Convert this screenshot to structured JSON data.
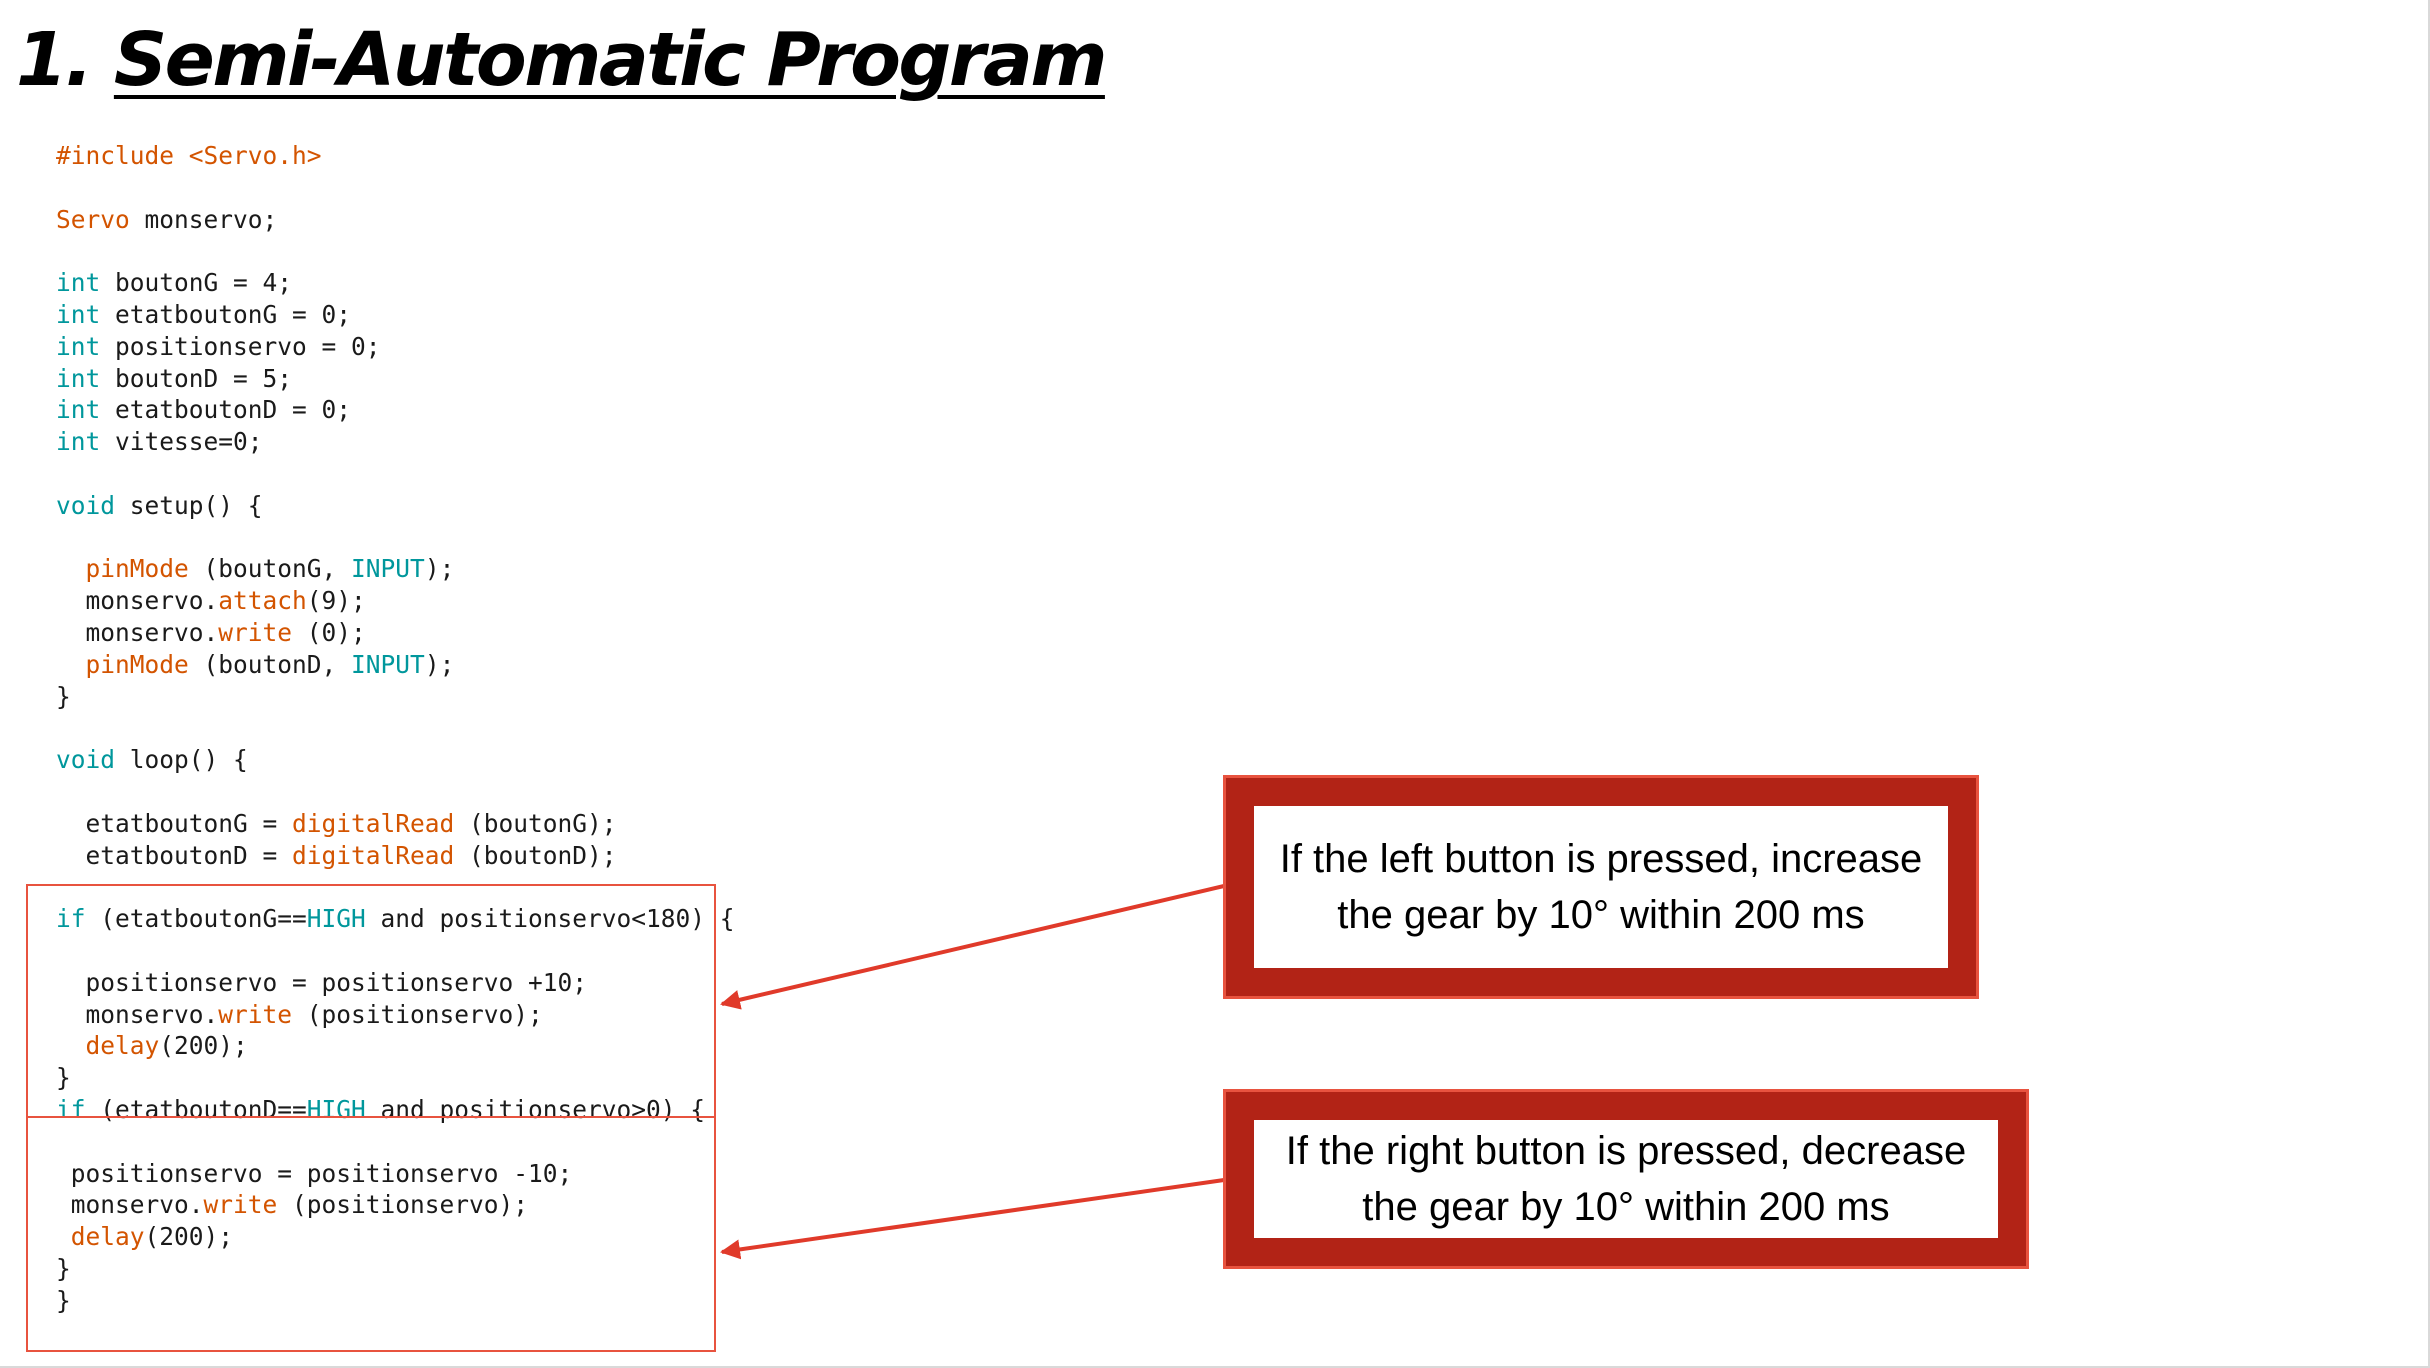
{
  "slide": {
    "title_number": "1.",
    "title_text": "Semi-Automatic Program"
  },
  "code": {
    "include_directive": "#include",
    "include_header": "<Servo.h>",
    "servo_type": "Servo",
    "servo_decl": " monservo;",
    "int_kw": "int",
    "void_kw": "void",
    "vars": [
      " boutonG = 4;",
      " etatboutonG = 0;",
      " positionservo = 0;",
      " boutonD = 5;",
      " etatboutonD = 0;",
      " vitesse=0;"
    ],
    "setup_sig": " setup() {",
    "loop_sig": " loop() {",
    "pinMode": "pinMode",
    "attach": "attach",
    "write": "write",
    "digitalRead": "digitalRead",
    "delay": "delay",
    "INPUT": "INPUT",
    "HIGH": "HIGH",
    "if_kw": "if",
    "setup_lines": [
      " (boutonG, ",
      ");",
      "monservo.",
      "(9);",
      "monservo.",
      " (0);",
      " (boutonD, ",
      ");"
    ],
    "loop_reads": [
      "etatboutonG = ",
      " (boutonG);",
      "etatboutonD = ",
      " (boutonD);"
    ],
    "if_left": {
      "cond_start": " (etatboutonG==",
      "cond_end": " and positionservo<180) {",
      "line1": "positionservo = positionservo +10;",
      "line2_pre": "monservo.",
      "line2_post": " (positionservo);",
      "line3_post": "(200);"
    },
    "if_right": {
      "cond_start": " (etatboutonD==",
      "cond_end": " and positionservo>0) {",
      "line1": "positionservo = positionservo -10;",
      "line2_pre": "monservo.",
      "line2_post": " (positionservo);",
      "line3_post": "(200);"
    },
    "close_brace": "}"
  },
  "callouts": {
    "left": {
      "line1": "If the left button is pressed, increase",
      "line2": "the gear by 10° within 200 ms"
    },
    "right": {
      "line1": "If the right button is pressed, decrease",
      "line2": "the gear by 10° within 200 ms"
    }
  },
  "colors": {
    "keyword": "#00979c",
    "function": "#d35400",
    "callout_border": "#b22316",
    "highlight_outline": "#e8533f",
    "arrow": "#e03a2a"
  }
}
